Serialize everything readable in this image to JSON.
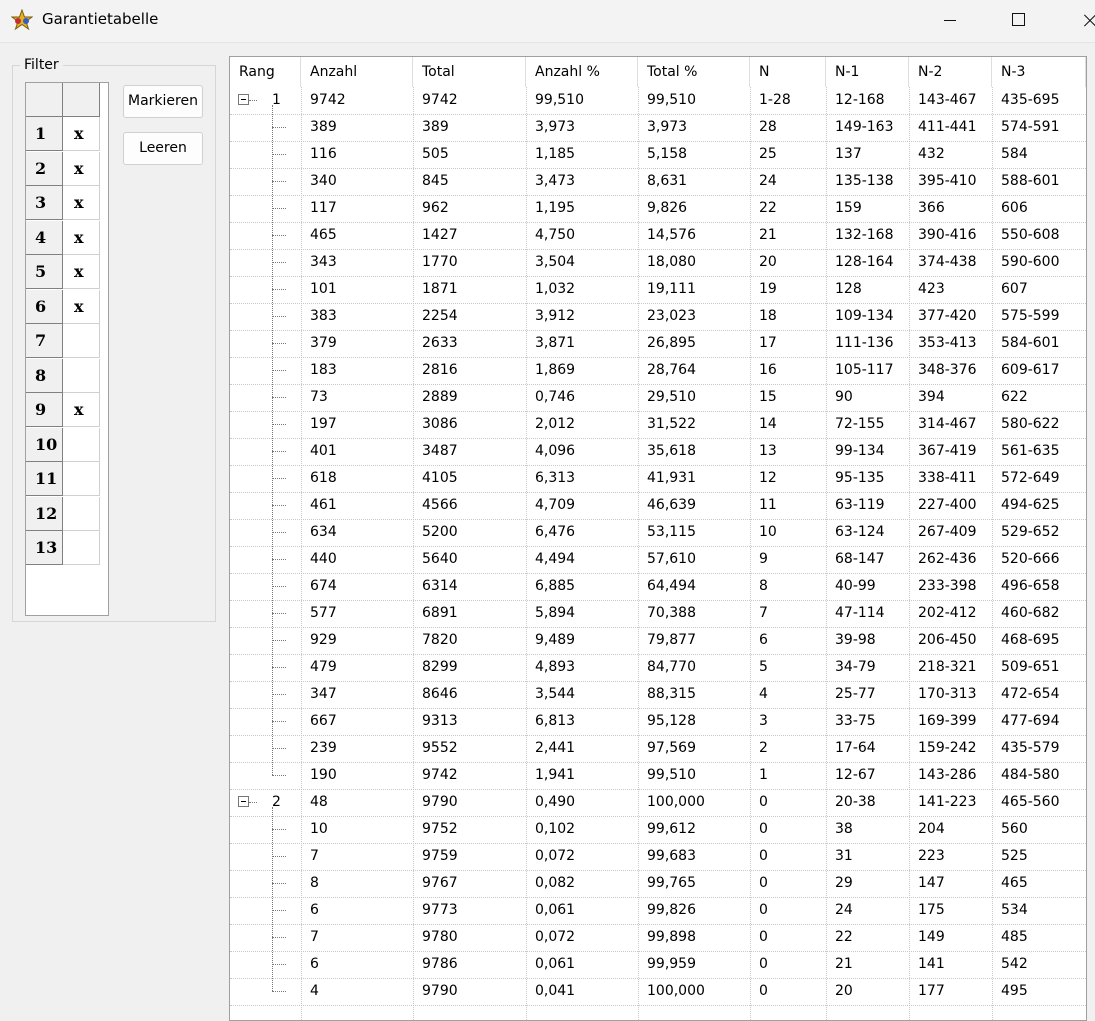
{
  "window": {
    "title": "Garantietabelle"
  },
  "filter": {
    "legend": "Filter",
    "rows": [
      {
        "num": "1",
        "val": "x"
      },
      {
        "num": "2",
        "val": "x"
      },
      {
        "num": "3",
        "val": "x"
      },
      {
        "num": "4",
        "val": "x"
      },
      {
        "num": "5",
        "val": "x"
      },
      {
        "num": "6",
        "val": "x"
      },
      {
        "num": "7",
        "val": ""
      },
      {
        "num": "8",
        "val": ""
      },
      {
        "num": "9",
        "val": "x"
      },
      {
        "num": "10",
        "val": ""
      },
      {
        "num": "11",
        "val": ""
      },
      {
        "num": "12",
        "val": ""
      },
      {
        "num": "13",
        "val": ""
      }
    ],
    "markieren_label": "Markieren",
    "leeren_label": "Leeren"
  },
  "table": {
    "columns": [
      "Rang",
      "Anzahl",
      "Total",
      "Anzahl %",
      "Total %",
      "N",
      "N-1",
      "N-2",
      "N-3"
    ],
    "rows": [
      {
        "rang": "1",
        "group": true,
        "cells": [
          "9742",
          "9742",
          "99,510",
          "99,510",
          "1-28",
          "12-168",
          "143-467",
          "435-695"
        ]
      },
      {
        "cells": [
          "389",
          "389",
          "3,973",
          "3,973",
          "28",
          "149-163",
          "411-441",
          "574-591"
        ]
      },
      {
        "cells": [
          "116",
          "505",
          "1,185",
          "5,158",
          "25",
          "137",
          "432",
          "584"
        ]
      },
      {
        "cells": [
          "340",
          "845",
          "3,473",
          "8,631",
          "24",
          "135-138",
          "395-410",
          "588-601"
        ]
      },
      {
        "cells": [
          "117",
          "962",
          "1,195",
          "9,826",
          "22",
          "159",
          "366",
          "606"
        ]
      },
      {
        "cells": [
          "465",
          "1427",
          "4,750",
          "14,576",
          "21",
          "132-168",
          "390-416",
          "550-608"
        ]
      },
      {
        "cells": [
          "343",
          "1770",
          "3,504",
          "18,080",
          "20",
          "128-164",
          "374-438",
          "590-600"
        ]
      },
      {
        "cells": [
          "101",
          "1871",
          "1,032",
          "19,111",
          "19",
          "128",
          "423",
          "607"
        ]
      },
      {
        "cells": [
          "383",
          "2254",
          "3,912",
          "23,023",
          "18",
          "109-134",
          "377-420",
          "575-599"
        ]
      },
      {
        "cells": [
          "379",
          "2633",
          "3,871",
          "26,895",
          "17",
          "111-136",
          "353-413",
          "584-601"
        ]
      },
      {
        "cells": [
          "183",
          "2816",
          "1,869",
          "28,764",
          "16",
          "105-117",
          "348-376",
          "609-617"
        ]
      },
      {
        "cells": [
          "73",
          "2889",
          "0,746",
          "29,510",
          "15",
          "90",
          "394",
          "622"
        ]
      },
      {
        "cells": [
          "197",
          "3086",
          "2,012",
          "31,522",
          "14",
          "72-155",
          "314-467",
          "580-622"
        ]
      },
      {
        "cells": [
          "401",
          "3487",
          "4,096",
          "35,618",
          "13",
          "99-134",
          "367-419",
          "561-635"
        ]
      },
      {
        "cells": [
          "618",
          "4105",
          "6,313",
          "41,931",
          "12",
          "95-135",
          "338-411",
          "572-649"
        ]
      },
      {
        "cells": [
          "461",
          "4566",
          "4,709",
          "46,639",
          "11",
          "63-119",
          "227-400",
          "494-625"
        ]
      },
      {
        "cells": [
          "634",
          "5200",
          "6,476",
          "53,115",
          "10",
          "63-124",
          "267-409",
          "529-652"
        ]
      },
      {
        "cells": [
          "440",
          "5640",
          "4,494",
          "57,610",
          "9",
          "68-147",
          "262-436",
          "520-666"
        ]
      },
      {
        "cells": [
          "674",
          "6314",
          "6,885",
          "64,494",
          "8",
          "40-99",
          "233-398",
          "496-658"
        ]
      },
      {
        "cells": [
          "577",
          "6891",
          "5,894",
          "70,388",
          "7",
          "47-114",
          "202-412",
          "460-682"
        ]
      },
      {
        "cells": [
          "929",
          "7820",
          "9,489",
          "79,877",
          "6",
          "39-98",
          "206-450",
          "468-695"
        ]
      },
      {
        "cells": [
          "479",
          "8299",
          "4,893",
          "84,770",
          "5",
          "34-79",
          "218-321",
          "509-651"
        ]
      },
      {
        "cells": [
          "347",
          "8646",
          "3,544",
          "88,315",
          "4",
          "25-77",
          "170-313",
          "472-654"
        ]
      },
      {
        "cells": [
          "667",
          "9313",
          "6,813",
          "95,128",
          "3",
          "33-75",
          "169-399",
          "477-694"
        ]
      },
      {
        "cells": [
          "239",
          "9552",
          "2,441",
          "97,569",
          "2",
          "17-64",
          "159-242",
          "435-579"
        ]
      },
      {
        "cells": [
          "190",
          "9742",
          "1,941",
          "99,510",
          "1",
          "12-67",
          "143-286",
          "484-580"
        ]
      },
      {
        "rang": "2",
        "group": true,
        "cells": [
          "48",
          "9790",
          "0,490",
          "100,000",
          "0",
          "20-38",
          "141-223",
          "465-560"
        ]
      },
      {
        "cells": [
          "10",
          "9752",
          "0,102",
          "99,612",
          "0",
          "38",
          "204",
          "560"
        ]
      },
      {
        "cells": [
          "7",
          "9759",
          "0,072",
          "99,683",
          "0",
          "31",
          "223",
          "525"
        ]
      },
      {
        "cells": [
          "8",
          "9767",
          "0,082",
          "99,765",
          "0",
          "29",
          "147",
          "465"
        ]
      },
      {
        "cells": [
          "6",
          "9773",
          "0,061",
          "99,826",
          "0",
          "24",
          "175",
          "534"
        ]
      },
      {
        "cells": [
          "7",
          "9780",
          "0,072",
          "99,898",
          "0",
          "22",
          "149",
          "485"
        ]
      },
      {
        "cells": [
          "6",
          "9786",
          "0,061",
          "99,959",
          "0",
          "21",
          "141",
          "542"
        ]
      },
      {
        "cells": [
          "4",
          "9790",
          "0,041",
          "100,000",
          "0",
          "20",
          "177",
          "495"
        ]
      }
    ]
  }
}
